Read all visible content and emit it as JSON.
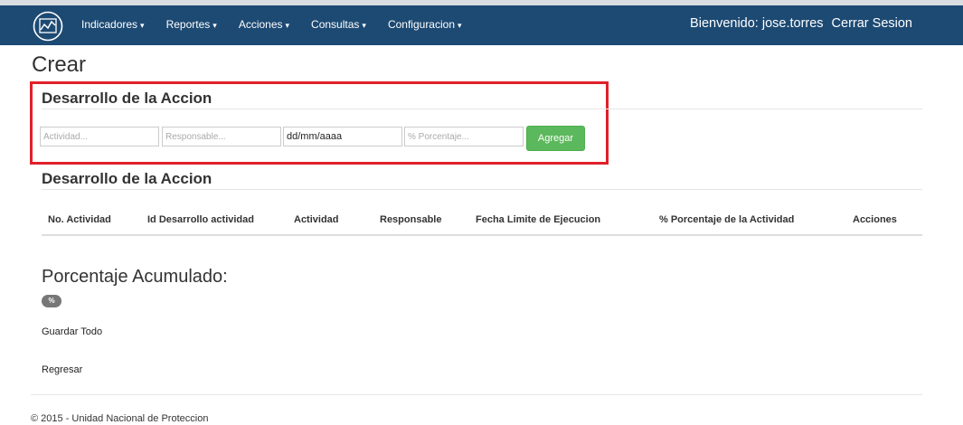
{
  "navbar": {
    "brand_icon": "chart-line-icon",
    "menu": [
      {
        "label": "Indicadores"
      },
      {
        "label": "Reportes"
      },
      {
        "label": "Acciones"
      },
      {
        "label": "Consultas"
      },
      {
        "label": "Configuracion"
      }
    ],
    "caret": "▾",
    "welcome": "Bienvenido: jose.torres",
    "logout": "Cerrar Sesion",
    "background": "#1d4a73"
  },
  "page": {
    "title": "Crear"
  },
  "form": {
    "section_title": "Desarrollo de la Accion",
    "actividad_placeholder": "Actividad...",
    "responsable_placeholder": "Responsable...",
    "fecha_value": "dd/mm/aaaa",
    "porcentaje_placeholder": "% Porcentaje...",
    "add_button": "Agregar",
    "highlight_color": "#e0202a",
    "button_color": "#5cb85c"
  },
  "table": {
    "section_title": "Desarrollo de la Accion",
    "headers": [
      "No. Actividad",
      "Id Desarrollo actividad",
      "Actividad",
      "Responsable",
      "Fecha Limite de Ejecucion",
      "% Porcentaje de la Actividad",
      "Acciones"
    ]
  },
  "accumulated": {
    "title": "Porcentaje Acumulado:",
    "badge": "%"
  },
  "actions": {
    "save_all": "Guardar Todo",
    "back": "Regresar"
  },
  "footer": {
    "text": "© 2015 - Unidad Nacional de Proteccion"
  }
}
